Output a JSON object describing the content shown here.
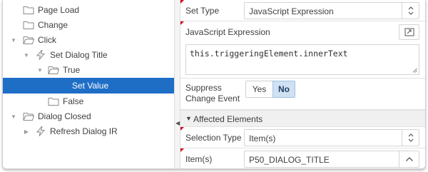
{
  "tree": {
    "items": [
      {
        "label": "Page Load"
      },
      {
        "label": "Change"
      },
      {
        "label": "Click"
      },
      {
        "label": "Set Dialog Title"
      },
      {
        "label": "True"
      },
      {
        "label": "Set Value"
      },
      {
        "label": "False"
      },
      {
        "label": "Dialog Closed"
      },
      {
        "label": "Refresh Dialog IR"
      }
    ],
    "selected_label": "Set Value"
  },
  "properties": {
    "set_type": {
      "label": "Set Type",
      "value": "JavaScript Expression"
    },
    "js_expression": {
      "label": "JavaScript Expression",
      "value": "this.triggeringElement.innerText"
    },
    "suppress_change_event": {
      "label_line1": "Suppress",
      "label_line2": "Change Event",
      "options": [
        "Yes",
        "No"
      ],
      "selected": "No"
    },
    "affected_elements": {
      "label": "Affected Elements"
    },
    "selection_type": {
      "label": "Selection Type",
      "value": "Item(s)"
    },
    "items": {
      "label": "Item(s)",
      "value": "P50_DIALOG_TITLE"
    }
  },
  "colors": {
    "selection": "#1e6ec6",
    "required_marker": "#d0021b",
    "toggle_active": "#cfe1f3"
  }
}
